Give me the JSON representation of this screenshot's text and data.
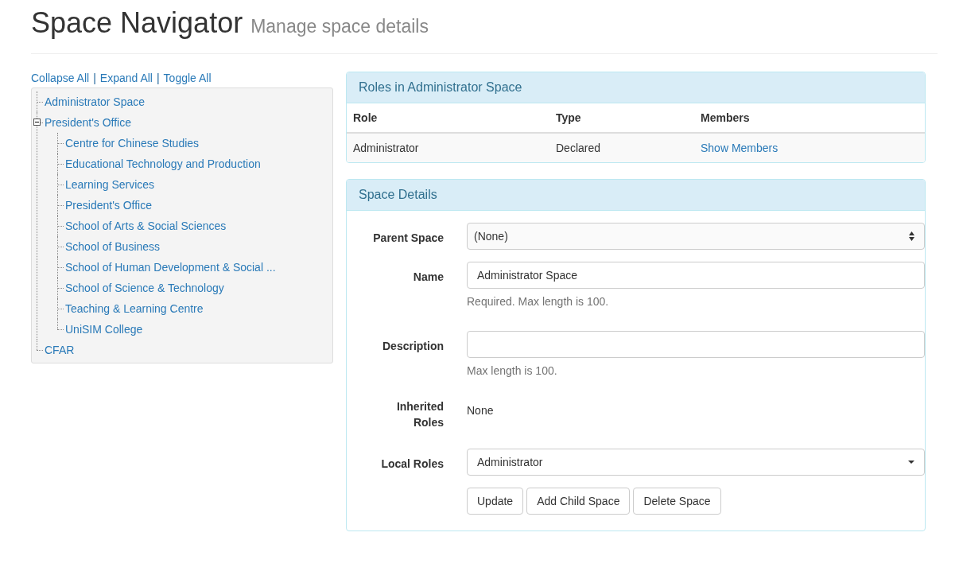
{
  "header": {
    "title": "Space Navigator",
    "subtitle": "Manage space details"
  },
  "tree_actions": [
    {
      "kind": "link",
      "text": "Collapse All"
    },
    {
      "kind": "separator",
      "text": "|"
    },
    {
      "kind": "link",
      "text": "Expand All"
    },
    {
      "kind": "separator",
      "text": "|"
    },
    {
      "kind": "link",
      "text": "Toggle All"
    }
  ],
  "tree": [
    {
      "label": "Administrator Space"
    },
    {
      "label": "President's Office",
      "expanded": true,
      "children": [
        {
          "label": "Centre for Chinese Studies"
        },
        {
          "label": "Educational Technology and Production"
        },
        {
          "label": "Learning Services"
        },
        {
          "label": "President's Office"
        },
        {
          "label": "School of Arts & Social Sciences"
        },
        {
          "label": "School of Business"
        },
        {
          "label": "School of Human Development & Social ..."
        },
        {
          "label": "School of Science & Technology"
        },
        {
          "label": "Teaching & Learning Centre"
        },
        {
          "label": "UniSIM College"
        }
      ]
    },
    {
      "label": "CFAR"
    }
  ],
  "roles_panel": {
    "title": "Roles in Administrator Space",
    "columns": [
      "Role",
      "Type",
      "Members"
    ],
    "rows": [
      [
        "Administrator",
        "Declared",
        "Show Members"
      ]
    ]
  },
  "details_panel": {
    "title": "Space Details",
    "fields": [
      {
        "kind": "select",
        "label": "Parent Space",
        "value": "(None)"
      },
      {
        "kind": "input",
        "label": "Name",
        "value": "Administrator Space",
        "help": "Required. Max length is 100."
      },
      {
        "kind": "input",
        "label": "Description",
        "help": "Max length is 100."
      },
      {
        "kind": "static",
        "label": "Inherited Roles",
        "value": "None"
      },
      {
        "kind": "dropdown",
        "label": "Local Roles",
        "value": "Administrator"
      }
    ],
    "buttons": [
      "Update",
      "Add Child Space",
      "Delete Space"
    ]
  }
}
